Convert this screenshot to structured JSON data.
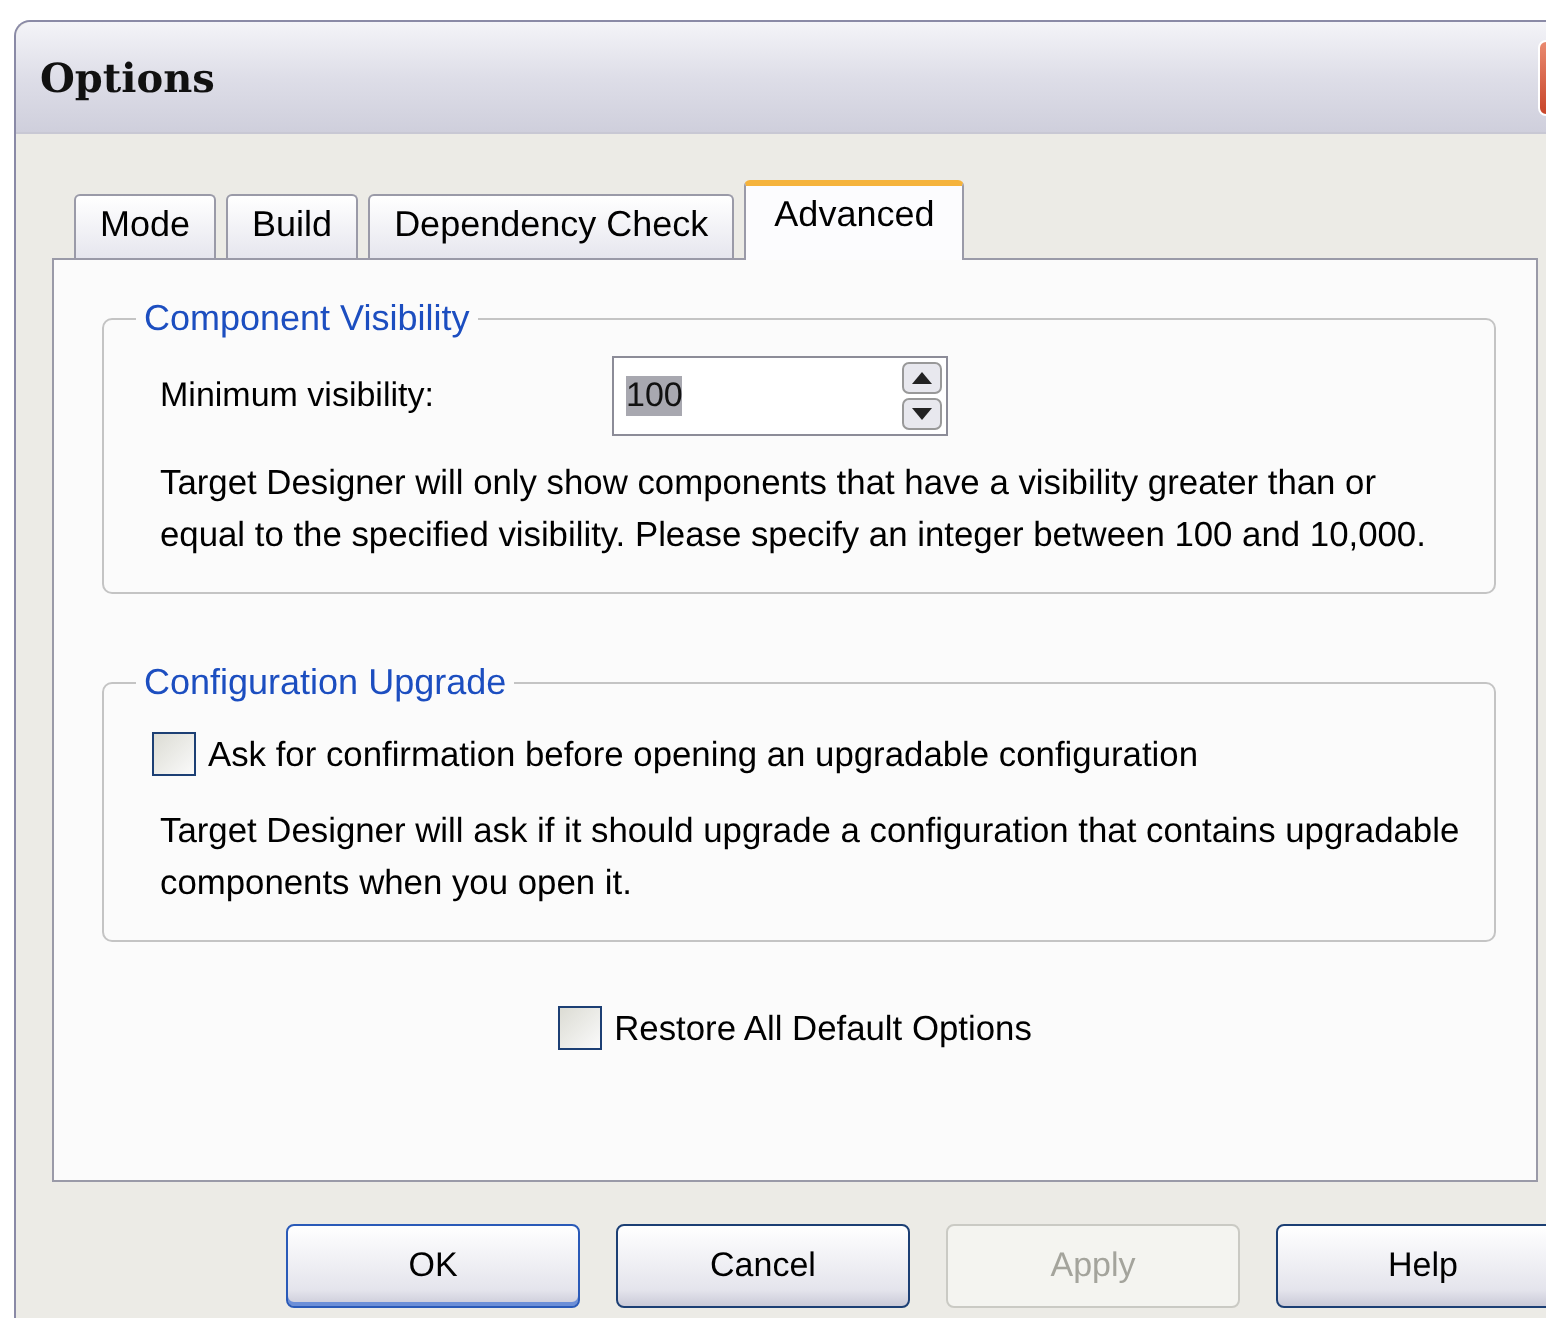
{
  "window": {
    "title": "Options"
  },
  "tabs": [
    {
      "label": "Mode",
      "selected": false
    },
    {
      "label": "Build",
      "selected": false
    },
    {
      "label": "Dependency Check",
      "selected": false
    },
    {
      "label": "Advanced",
      "selected": true
    }
  ],
  "groups": [
    {
      "title": "Component Visibility",
      "items": [
        {
          "kind": "spinner",
          "label": "Minimum visibility:",
          "value": "100"
        },
        {
          "kind": "note",
          "text": "Target Designer will only show components that have a visibility greater than or equal to the specified visibility.  Please specify an integer between 100 and 10,000."
        }
      ]
    },
    {
      "title": "Configuration Upgrade",
      "items": [
        {
          "kind": "checkbox",
          "label": "Ask for confirmation before opening an upgradable configuration",
          "checked": false
        },
        {
          "kind": "note",
          "text": "Target Designer will ask if it should upgrade a configuration that contains upgradable components when you open it."
        }
      ]
    }
  ],
  "restore": {
    "label": "Restore All Default Options",
    "checked": false
  },
  "buttons": [
    {
      "label": "OK",
      "default": true,
      "disabled": false
    },
    {
      "label": "Cancel",
      "default": false,
      "disabled": false
    },
    {
      "label": "Apply",
      "default": false,
      "disabled": true
    },
    {
      "label": "Help",
      "default": false,
      "disabled": false
    }
  ]
}
